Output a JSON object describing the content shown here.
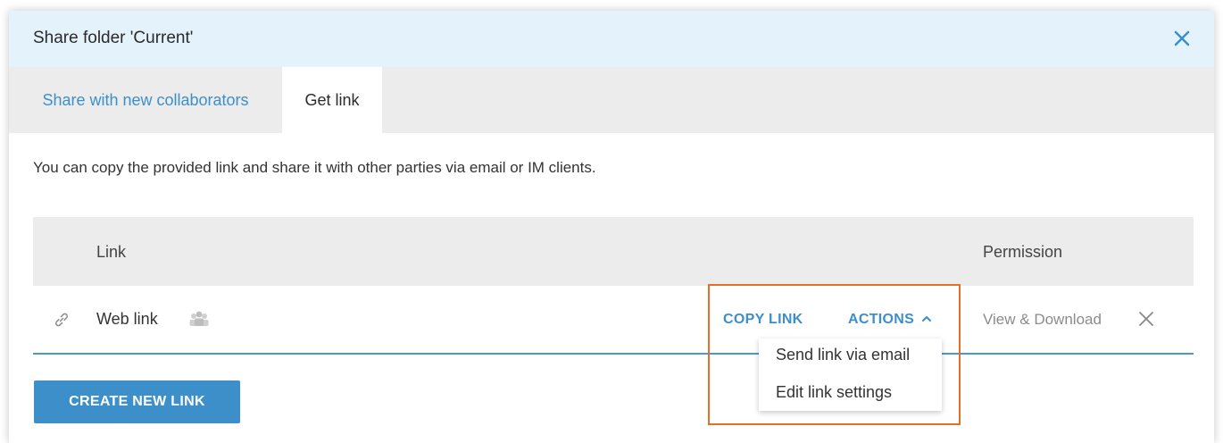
{
  "dialog": {
    "title": "Share folder 'Current'",
    "close_icon": "close-icon"
  },
  "tabs": [
    {
      "label": "Share with new collaborators",
      "active": false
    },
    {
      "label": "Get link",
      "active": true
    }
  ],
  "description": "You can copy the provided link and share it with other parties via email or IM clients.",
  "table": {
    "headers": {
      "link": "Link",
      "permission": "Permission"
    },
    "rows": [
      {
        "icon": "link-icon",
        "name": "Web link",
        "audience_icon": "people-icon",
        "copy_label": "COPY LINK",
        "actions_label": "ACTIONS",
        "permission": "View & Download",
        "remove_icon": "close-icon"
      }
    ]
  },
  "create_button": "CREATE NEW LINK",
  "actions_menu": {
    "items": [
      "Send link via email",
      "Edit link settings"
    ]
  },
  "colors": {
    "accent": "#3d8fc9",
    "titlebar": "#e4f2fb",
    "header_bg": "#ececec",
    "highlight": "#e46f25"
  }
}
